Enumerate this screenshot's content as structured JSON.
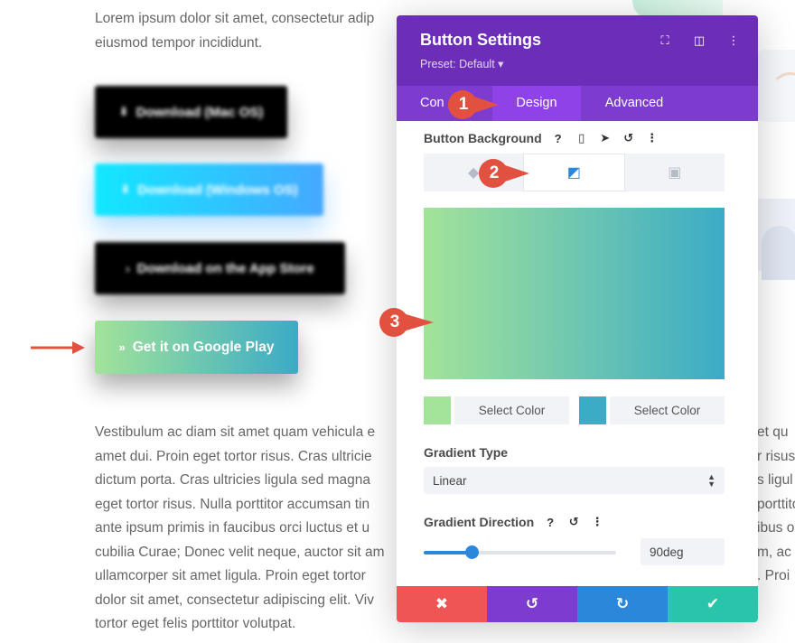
{
  "background": {
    "intro_text": "Lorem ipsum dolor sit amet, consectetur adipiscing elit, sed do eiusmod tempor incididunt.",
    "intro_line1": "Lorem ipsum dolor sit amet, consectetur adip",
    "intro_line2": "eiusmod tempor incididunt.",
    "body_lines": [
      "Vestibulum ac diam sit amet quam vehicula e",
      "amet dui. Proin eget tortor risus. Cras ultricie",
      "dictum porta. Cras ultricies ligula sed magna",
      "eget tortor risus. Nulla porttitor accumsan tin",
      "ante ipsum primis in faucibus orci luctus et u",
      "cubilia Curae; Donec velit neque, auctor sit am",
      "ullamcorper sit amet ligula. Proin eget tortor",
      "dolor sit amet, consectetur adipiscing elit. Viv",
      "tortor eget felis porttitor volutpat."
    ],
    "right_fragments": [
      "et qu",
      "r risus",
      "s ligul",
      "porttito",
      "ibus o",
      "m, ac",
      ". Proi",
      "",
      ""
    ]
  },
  "demo_buttons": [
    {
      "label": "Download (Mac OS)",
      "icon": "download-icon"
    },
    {
      "label": "Download (Windows OS)",
      "icon": "download-icon"
    },
    {
      "label": "Download on the App Store",
      "icon": "chevron-icon"
    },
    {
      "label": "Get it on Google Play",
      "icon": "double-chevron-icon"
    }
  ],
  "panel": {
    "title": "Button Settings",
    "preset": "Preset: Default ▾",
    "tabs": [
      "Content",
      "Design",
      "Advanced"
    ],
    "tab_content_visible": "Con",
    "button_background_label": "Button Background",
    "gradient_start_color": "#a3e39a",
    "gradient_end_color": "#3babc6",
    "select_color_label": "Select Color",
    "gradient_type_label": "Gradient Type",
    "gradient_type_value": "Linear",
    "gradient_direction_label": "Gradient Direction",
    "gradient_direction_value": "90deg",
    "direction_slider_value": 90,
    "direction_slider_max": 360
  },
  "callouts": [
    "1",
    "2",
    "3"
  ],
  "colors": {
    "panel_header": "#6c2eb9",
    "tabs_bar": "#7e3bd0",
    "cancel": "#ef5555",
    "undo": "#7e3bd0",
    "redo": "#2b87da",
    "save": "#29c4a9",
    "callout": "#e2513f",
    "arrow": "#e2513f"
  }
}
